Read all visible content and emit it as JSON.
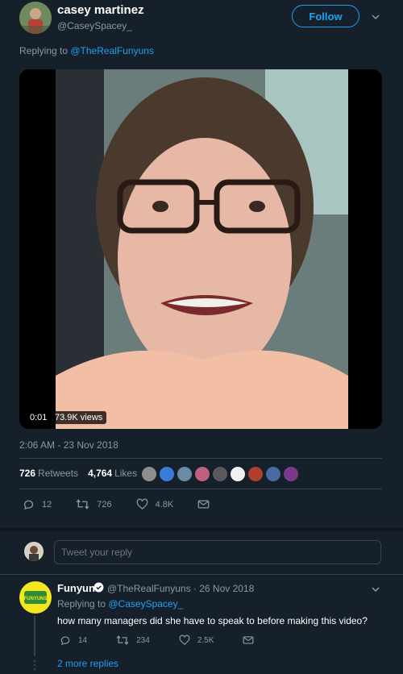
{
  "author": {
    "name": "casey martinez",
    "handle": "@CaseySpacey_",
    "follow_label": "Follow"
  },
  "replying": {
    "prefix": "Replying to ",
    "target": "@TheRealFunyuns"
  },
  "video": {
    "time": "0:01",
    "views": "73.9K views"
  },
  "timestamp": "2:06 AM - 23 Nov 2018",
  "stats": {
    "retweets_count": "726",
    "retweets_label": "Retweets",
    "likes_count": "4,764",
    "likes_label": "Likes"
  },
  "likers_colors": [
    "#8d8d8d",
    "#3a7bd5",
    "#6a8aa5",
    "#c06080",
    "#5a5a5a",
    "#f0f0f0",
    "#b0402a",
    "#4a6aa0",
    "#7a3a8a"
  ],
  "actions": {
    "replies": "12",
    "retweets": "726",
    "likes": "4.8K"
  },
  "reply_box": {
    "placeholder": "Tweet your reply"
  },
  "reply_tweet": {
    "name": "Funyuns",
    "meta": "@TheRealFunyuns · 26 Nov 2018",
    "replying_prefix": "Replying to ",
    "replying_target": "@CaseySpacey_",
    "text": "how many managers did she have to speak to before making this video?",
    "replies": "14",
    "retweets": "234",
    "likes": "2.5K",
    "logo_text": "FUNYUNS"
  },
  "more_replies": "2 more replies",
  "colors": {
    "background": "#15202b",
    "accent": "#1da1f2",
    "muted": "#8899a6",
    "border": "#38444d"
  }
}
